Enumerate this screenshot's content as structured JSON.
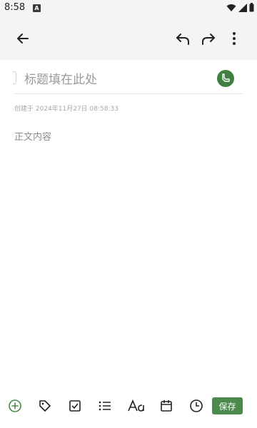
{
  "status": {
    "time": "8:58",
    "notif_letter": "A"
  },
  "appbar": {
    "back_icon": "arrow-left-icon",
    "undo_icon": "undo-icon",
    "redo_icon": "redo-icon",
    "more_icon": "more-vert-icon"
  },
  "editor": {
    "title_placeholder": "标题填在此处",
    "created_text": "创建于 2024年11月27日 08:58:33",
    "body_placeholder": "正文内容",
    "tag_icon": "category-icon"
  },
  "toolbar": {
    "items": [
      "add-icon",
      "tag-icon",
      "checkbox-icon",
      "list-icon",
      "text-format-icon",
      "calendar-icon",
      "clock-icon"
    ],
    "save_label": "保存"
  },
  "colors": {
    "accent": "#4b8a4b",
    "appbar_bg": "#f4f3f5",
    "placeholder": "#9a9a9a"
  }
}
